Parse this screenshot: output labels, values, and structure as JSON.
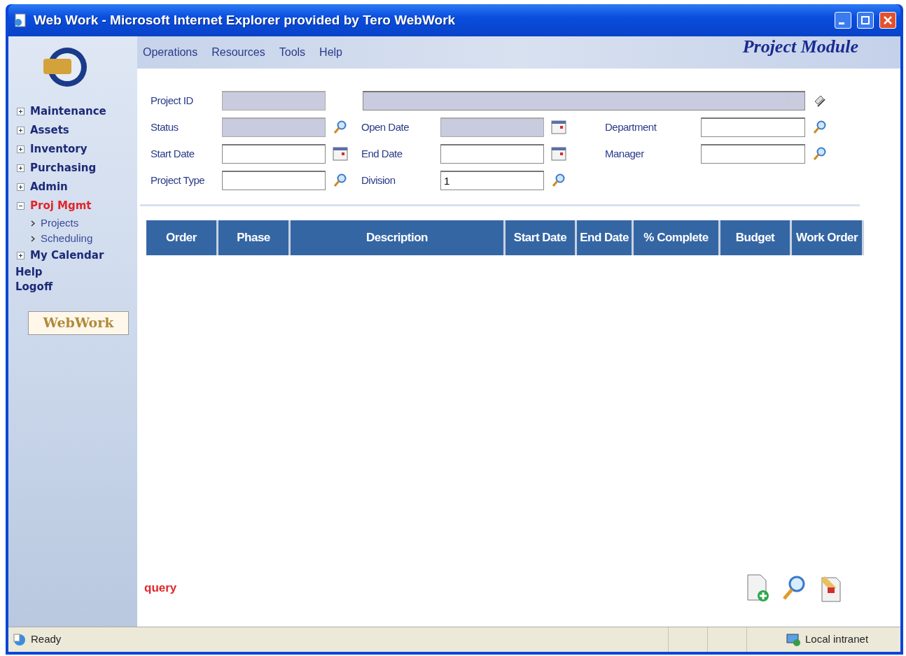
{
  "window": {
    "title": "Web Work - Microsoft Internet Explorer provided by Tero WebWork"
  },
  "menu": [
    {
      "label": "Operations"
    },
    {
      "label": "Resources"
    },
    {
      "label": "Tools"
    },
    {
      "label": "Help"
    }
  ],
  "module_title": "Project Module",
  "sidebar": {
    "items": [
      {
        "kind": "tree",
        "label": "Maintenance",
        "expanded": false,
        "selected": false
      },
      {
        "kind": "tree",
        "label": "Assets",
        "expanded": false,
        "selected": false
      },
      {
        "kind": "tree",
        "label": "Inventory",
        "expanded": false,
        "selected": false
      },
      {
        "kind": "tree",
        "label": "Purchasing",
        "expanded": false,
        "selected": false
      },
      {
        "kind": "tree",
        "label": "Admin",
        "expanded": false,
        "selected": false
      },
      {
        "kind": "tree",
        "label": "Proj Mgmt",
        "expanded": true,
        "selected": true,
        "children": [
          {
            "label": "Projects"
          },
          {
            "label": "Scheduling"
          }
        ]
      },
      {
        "kind": "tree",
        "label": "My Calendar",
        "expanded": false,
        "selected": false
      },
      {
        "kind": "link",
        "label": "Help"
      },
      {
        "kind": "link",
        "label": "Logoff"
      }
    ],
    "badge": "WebWork"
  },
  "form": {
    "rows": [
      [
        {
          "label": "Project ID",
          "kind": "plain",
          "disabled": true
        },
        {
          "kind": "spin",
          "disabled": true,
          "button": {
            "kind": "edit"
          }
        }
      ],
      [
        {
          "label": "Status",
          "kind": "plain",
          "disabled": true,
          "button": {
            "kind": "lookup"
          }
        },
        {
          "label": "Open Date",
          "kind": "plain",
          "disabled": true,
          "button": {
            "kind": "calendar"
          }
        },
        {
          "label": "Department",
          "kind": "plain",
          "disabled": false,
          "button": {
            "kind": "lookup"
          }
        }
      ],
      [
        {
          "label": "Start Date",
          "kind": "plain",
          "disabled": false,
          "button": {
            "kind": "calendar"
          }
        },
        {
          "label": "End Date",
          "kind": "plain",
          "disabled": false,
          "button": {
            "kind": "calendar"
          }
        },
        {
          "label": "Manager",
          "kind": "plain",
          "disabled": false,
          "button": {
            "kind": "lookup"
          }
        }
      ],
      [
        {
          "label": "Project Type",
          "kind": "plain",
          "disabled": false,
          "button": {
            "kind": "lookup"
          }
        },
        {
          "label": "Division",
          "kind": "plain",
          "disabled": false,
          "value": "1",
          "button": {
            "kind": "lookup"
          }
        }
      ]
    ]
  },
  "table": {
    "columns": [
      "Order",
      "Phase",
      "Description",
      "Start Date",
      "End Date",
      "% Complete",
      "Budget",
      "Work Order"
    ]
  },
  "mode_label": "query",
  "actions": [
    {
      "kind": "new"
    },
    {
      "kind": "search"
    },
    {
      "kind": "clear"
    }
  ],
  "status_bar": {
    "text": "Ready",
    "zone": "Local intranet"
  }
}
